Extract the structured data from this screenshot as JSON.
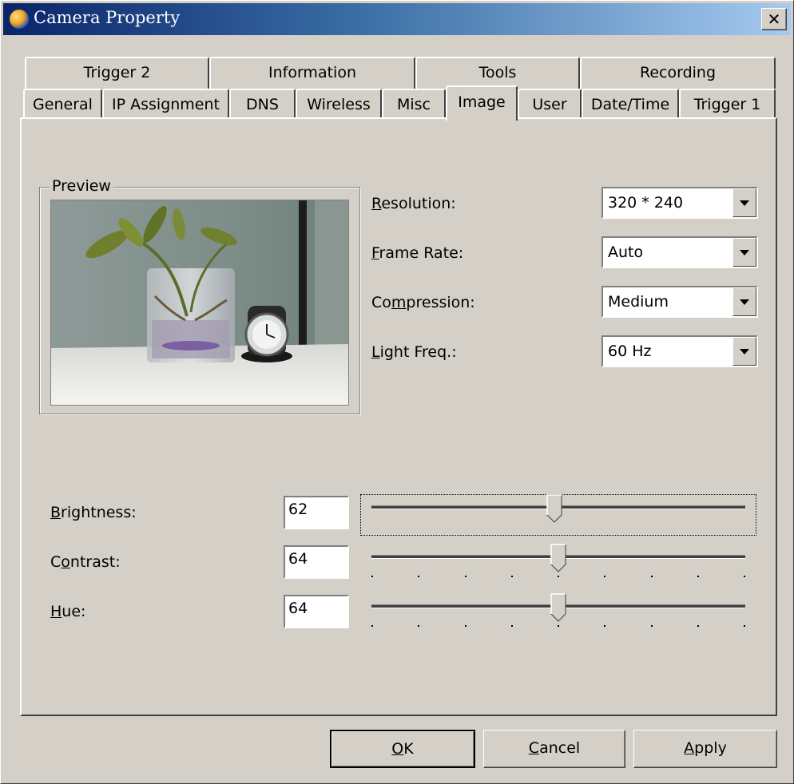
{
  "window": {
    "title": "Camera Property",
    "close_label": "✕"
  },
  "tabs": {
    "row1": [
      {
        "label": "Trigger 2"
      },
      {
        "label": "Information"
      },
      {
        "label": "Tools"
      },
      {
        "label": "Recording"
      }
    ],
    "row2": [
      {
        "label": "General"
      },
      {
        "label": "IP Assignment"
      },
      {
        "label": "DNS"
      },
      {
        "label": "Wireless"
      },
      {
        "label": "Misc"
      },
      {
        "label": "Image",
        "active": true
      },
      {
        "label": "User"
      },
      {
        "label": "Date/Time"
      },
      {
        "label": "Trigger 1"
      }
    ]
  },
  "preview": {
    "group_label": "Preview"
  },
  "settings": {
    "resolution": {
      "mnemonic": "R",
      "label_rest": "esolution:",
      "value": "320 * 240"
    },
    "frame_rate": {
      "mnemonic": "F",
      "label_rest": "rame Rate:",
      "value": "Auto"
    },
    "compression": {
      "label_pre": "Co",
      "mnemonic": "m",
      "label_rest": "pression:",
      "value": "Medium"
    },
    "light_freq": {
      "mnemonic": "L",
      "label_rest": "ight Freq.:",
      "value": "60 Hz"
    }
  },
  "adjustments": {
    "brightness": {
      "mnemonic": "B",
      "label_rest": "rightness:",
      "value": "62",
      "level": 0.49
    },
    "contrast": {
      "label_pre": "C",
      "mnemonic": "o",
      "label_rest": "ntrast:",
      "value": "64",
      "level": 0.5
    },
    "hue": {
      "mnemonic": "H",
      "label_rest": "ue:",
      "value": "64",
      "level": 0.5
    }
  },
  "buttons": {
    "ok": {
      "mnemonic": "O",
      "label_rest": "K"
    },
    "cancel": {
      "mnemonic": "C",
      "label_rest": "ancel"
    },
    "apply": {
      "mnemonic": "A",
      "label_rest": "pply"
    }
  }
}
